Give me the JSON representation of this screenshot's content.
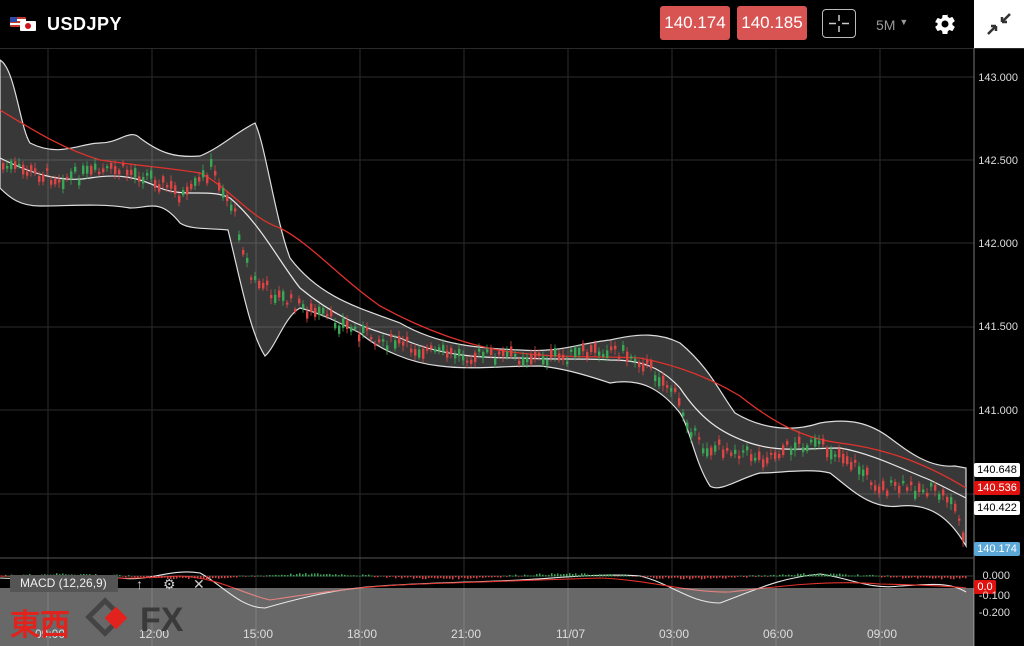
{
  "header": {
    "symbol": "USDJPY",
    "bid": "140.174",
    "ask": "140.185",
    "timeframe": "5M"
  },
  "price_axis": [
    "143.000",
    "142.500",
    "142.000",
    "141.500",
    "141.000"
  ],
  "price_tags": {
    "bb_upper": "140.648",
    "ma": "140.536",
    "bb_lower": "140.422",
    "last": "140.174"
  },
  "macd": {
    "label": "MACD (12,26,9)",
    "axis": [
      "0.000",
      "-0.100",
      "-0.200"
    ],
    "tag": "0.0"
  },
  "time_axis": [
    "09:00",
    "12:00",
    "15:00",
    "18:00",
    "21:00",
    "11/07",
    "03:00",
    "06:00",
    "09:00"
  ],
  "logo": {
    "kanji": "東西",
    "fx": "FX"
  },
  "colors": {
    "bid": "#d85452",
    "ask": "#d85452",
    "ma": "#e0322b",
    "last_tag": "#5aa7d8",
    "bull": "#3aa757",
    "bear": "#d44"
  }
}
